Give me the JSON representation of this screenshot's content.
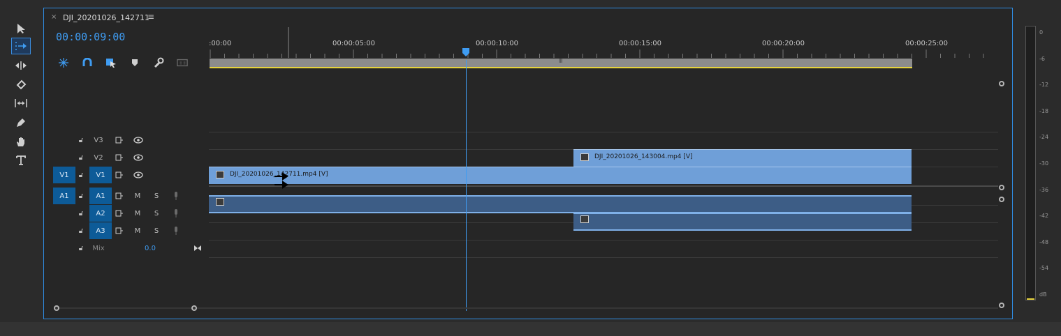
{
  "tools": [
    {
      "name": "selection-tool-icon",
      "active": false
    },
    {
      "name": "track-select-forward-tool-icon",
      "active": true
    },
    {
      "name": "ripple-edit-tool-icon",
      "active": false
    },
    {
      "name": "razor-tool-icon",
      "active": false
    },
    {
      "name": "slip-tool-icon",
      "active": false
    },
    {
      "name": "pen-tool-icon",
      "active": false
    },
    {
      "name": "hand-tool-icon",
      "active": false
    },
    {
      "name": "type-tool-icon",
      "active": false
    }
  ],
  "panel": {
    "close_glyph": "×",
    "title": "DJI_20201026_142711",
    "menu_glyph": "≡",
    "timecode": "00:00:09:00"
  },
  "timeline_controls": [
    "nest-sequence-icon",
    "snap-magnet-icon",
    "linked-selection-icon",
    "add-marker-icon",
    "settings-wrench-icon",
    "captions-icon"
  ],
  "ruler": {
    "labels": [
      ":00:00",
      "00:00:05:00",
      "00:00:10:00",
      "00:00:15:00",
      "00:00:20:00",
      "00:00:25:00"
    ],
    "scrub_grip": "Ⅲ"
  },
  "tracks": {
    "video": [
      {
        "name": "V3",
        "source_patch": ""
      },
      {
        "name": "V2",
        "source_patch": ""
      },
      {
        "name": "V1",
        "source_patch": "V1"
      }
    ],
    "audio": [
      {
        "name": "A1",
        "source_patch": "A1",
        "m": "M",
        "s": "S"
      },
      {
        "name": "A2",
        "source_patch": "",
        "m": "M",
        "s": "S"
      },
      {
        "name": "A3",
        "source_patch": "",
        "m": "M",
        "s": "S"
      }
    ],
    "mix": {
      "label": "Mix",
      "value": "0.0"
    }
  },
  "clips": {
    "v2": "DJI_20201026_143004.mp4 [V]",
    "v1": "DJI_20201026_142711.mp4 [V]"
  },
  "meter": {
    "labels": [
      "0",
      "-6",
      "-12",
      "-18",
      "-24",
      "-30",
      "-36",
      "-42",
      "-48",
      "-54",
      "dB"
    ]
  },
  "colors": {
    "accent": "#2f8de4",
    "clip_video": "#6f9fd8",
    "clip_audio": "#3d5d86",
    "patch_blue": "#0d5b98"
  }
}
